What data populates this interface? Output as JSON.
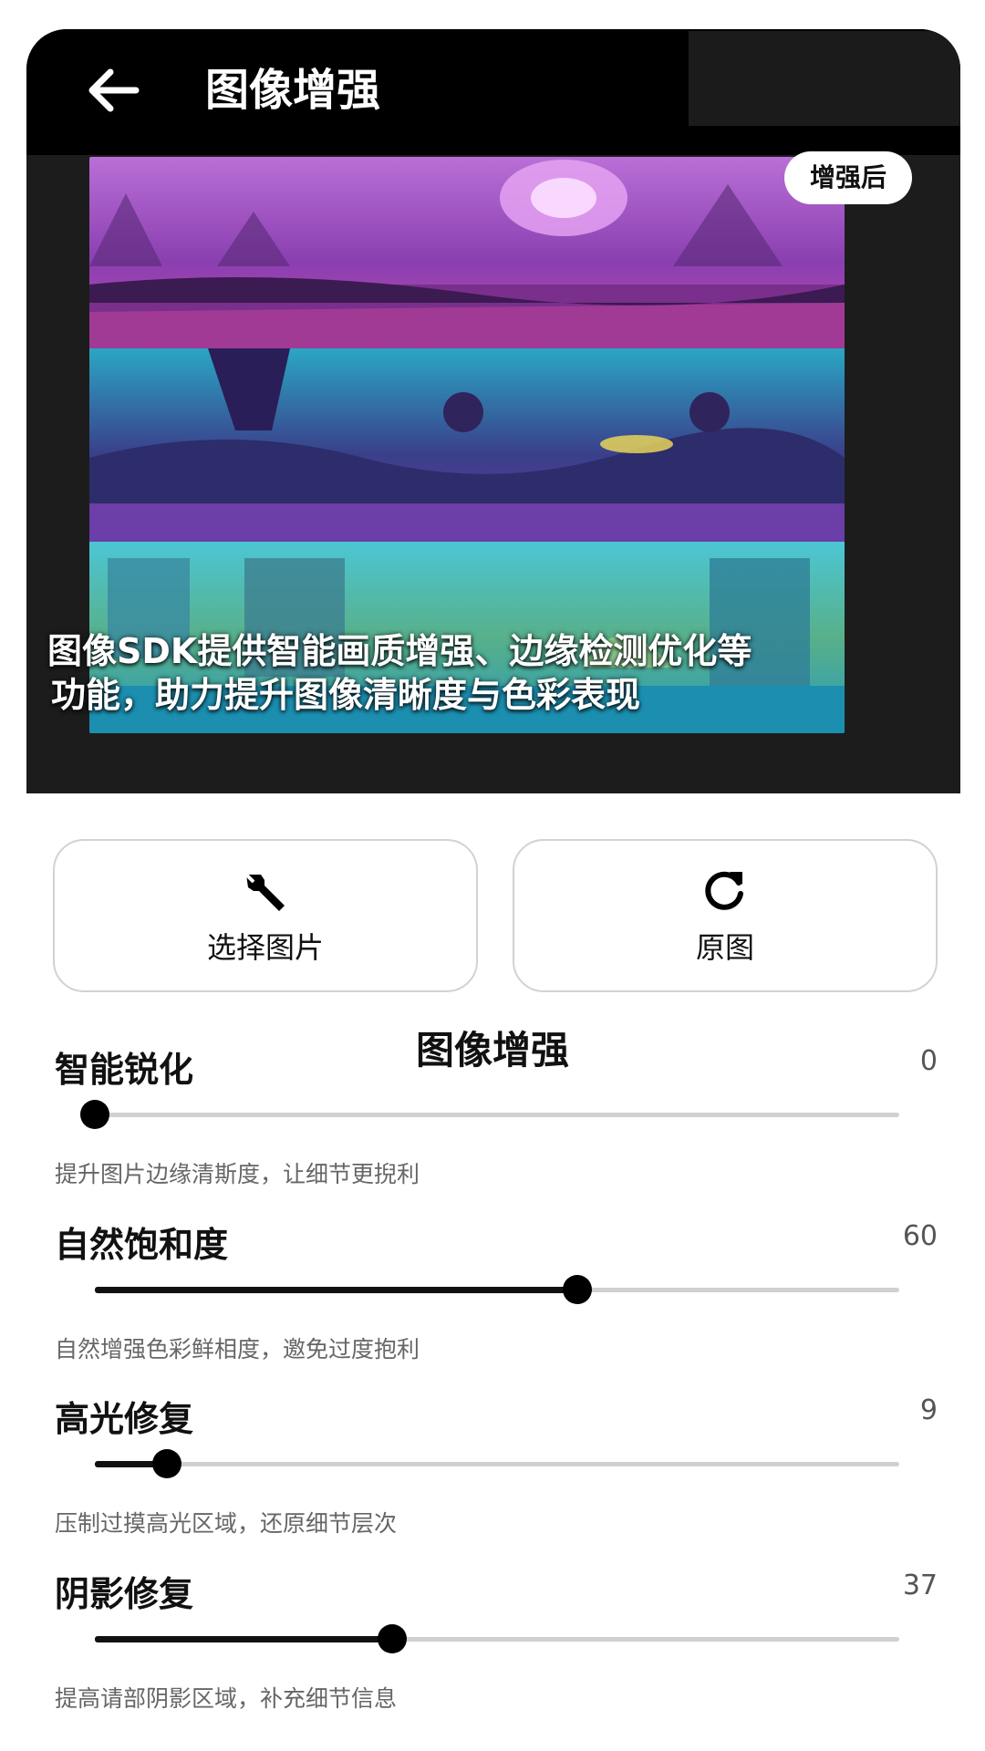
{
  "header": {
    "back_icon": "arrow-left-icon",
    "title": "图像增强"
  },
  "preview": {
    "badge": "增强后",
    "caption_line1": "图像SDK提供智能画质增强、边缘检测优化等",
    "caption_line2": "功能，助力提升图像清晰度与色彩表现"
  },
  "actions": {
    "select_image": {
      "label": "选择图片",
      "icon": "wrench-icon"
    },
    "original": {
      "label": "原图",
      "icon": "refresh-icon"
    }
  },
  "section_title": "图像增强",
  "settings": [
    {
      "name": "智能锐化",
      "value": "0",
      "level": 0,
      "desc": "提升图片边缘清斯度，让细节更掜利"
    },
    {
      "name": "自然饱和度",
      "value": "60",
      "level": 60,
      "desc": "自然增强色彩鲜相度，邀免过度抱利"
    },
    {
      "name": "高光修复",
      "value": "9",
      "level": 9,
      "desc": "压制过摸高光区域，还原细节层次"
    },
    {
      "name": "阴影修复",
      "value": "37",
      "level": 37,
      "desc": "提高请部阴影区域，补充细节信息"
    }
  ],
  "colors": {
    "topbar": "#000000",
    "card": "#1c1c1c",
    "slider_fill": "#111111",
    "slider_track": "#d0d0d0"
  }
}
